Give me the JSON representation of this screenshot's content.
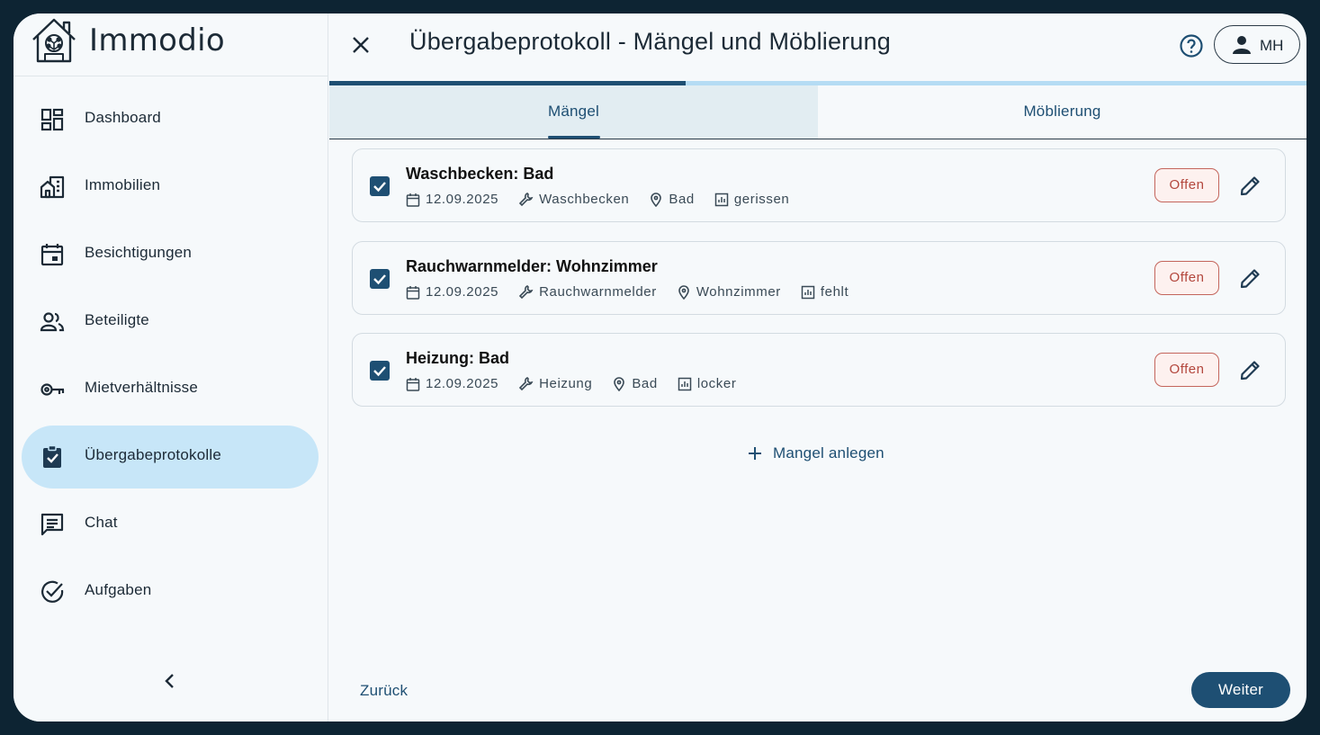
{
  "app": {
    "name": "Immodio"
  },
  "sidebar": {
    "items": [
      {
        "label": "Dashboard",
        "icon": "dashboard-icon"
      },
      {
        "label": "Immobilien",
        "icon": "building-icon"
      },
      {
        "label": "Besichtigungen",
        "icon": "calendar-icon"
      },
      {
        "label": "Beteiligte",
        "icon": "people-icon"
      },
      {
        "label": "Mietverhältnisse",
        "icon": "key-icon"
      },
      {
        "label": "Übergabeprotokolle",
        "icon": "clipboard-check-icon",
        "active": true
      },
      {
        "label": "Chat",
        "icon": "chat-icon"
      },
      {
        "label": "Aufgaben",
        "icon": "check-circle-icon"
      }
    ]
  },
  "header": {
    "title": "Übergabeprotokoll - Mängel und Möblierung",
    "user_initials": "MH",
    "progress": 0.365
  },
  "tabs": [
    {
      "label": "Mängel",
      "active": true
    },
    {
      "label": "Möblierung",
      "active": false
    }
  ],
  "defects": [
    {
      "title": "Waschbecken: Bad",
      "date": "12.09.2025",
      "item": "Waschbecken",
      "room": "Bad",
      "condition": "gerissen",
      "status": "Offen",
      "checked": true
    },
    {
      "title": "Rauchwarnmelder: Wohnzimmer",
      "date": "12.09.2025",
      "item": "Rauchwarnmelder",
      "room": "Wohnzimmer",
      "condition": "fehlt",
      "status": "Offen",
      "checked": true
    },
    {
      "title": "Heizung: Bad",
      "date": "12.09.2025",
      "item": "Heizung",
      "room": "Bad",
      "condition": "locker",
      "status": "Offen",
      "checked": true
    }
  ],
  "actions": {
    "add_defect": "Mangel anlegen",
    "back": "Zurück",
    "next": "Weiter"
  },
  "colors": {
    "primary": "#1e4f73",
    "active_nav": "#c7e6f8",
    "status_open": "#b3473d",
    "frame": "#0d2433"
  }
}
